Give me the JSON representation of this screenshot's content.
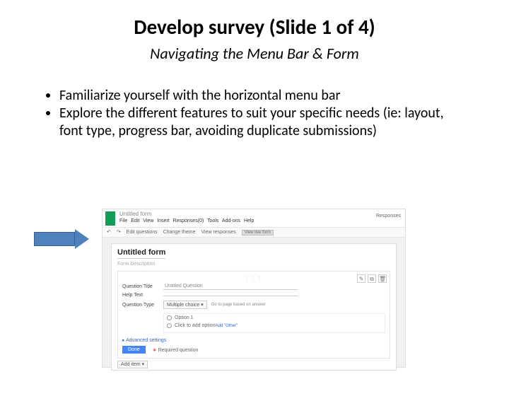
{
  "title": "Develop survey (Slide 1 of 4)",
  "subtitle": "Navigating the Menu Bar & Form",
  "bullets": [
    "Familiarize yourself with the horizontal menu bar",
    "Explore the different features to suit your specific needs (ie: layout, font type, progress bar, avoiding duplicate submissions)"
  ],
  "shot": {
    "doc_title": "Untitled form",
    "menu": "File  Edit  View  Insert  Responses(0)  Tools  Add-ons  Help",
    "responses": "Responses",
    "toolbar": {
      "edit_questions": "Edit questions",
      "change_theme": "Change theme",
      "view_responses": "View responses",
      "view_live": "View live form"
    },
    "form_title": "Untitled form",
    "form_desc": "Form Description",
    "labels": {
      "qtitle": "Question Title",
      "help": "Help Text",
      "qtype": "Question Type"
    },
    "qtitle_val": "Untitled Question",
    "qtype_val": "Multiple choice ▾",
    "qtype_hint": "Go to page based on answer",
    "option1": "Option 1",
    "add_option": "Click to add option",
    "add_other": "Add \"Other\"",
    "advanced": "▸ Advanced settings",
    "done": "Done",
    "required": "Required question",
    "add_item": "Add item ▾",
    "icons": {
      "edit": "✎",
      "dup": "⧉",
      "del": "🗑"
    }
  }
}
